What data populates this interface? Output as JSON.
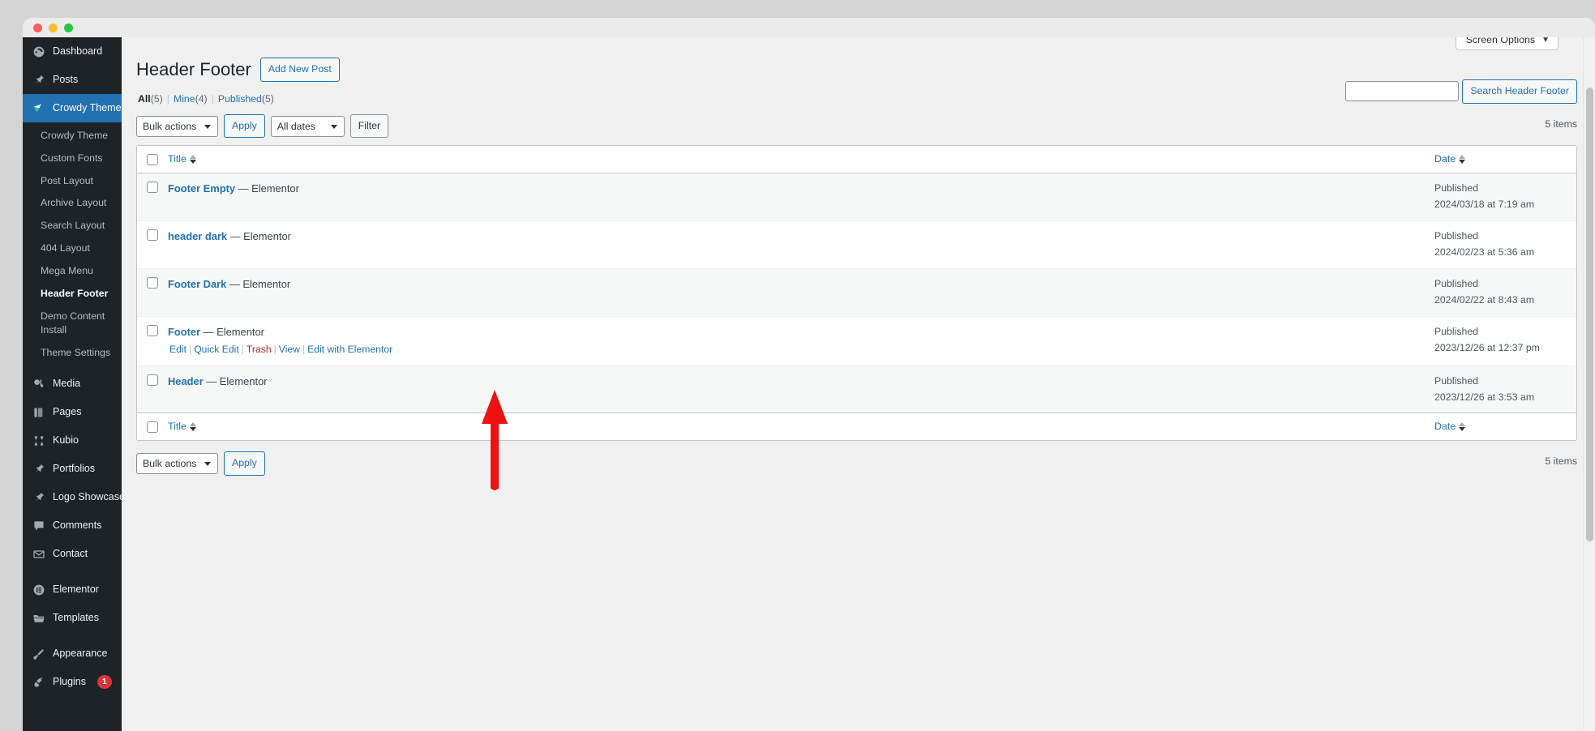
{
  "window": {
    "traffic_lights": [
      "close",
      "minimize",
      "maximize"
    ]
  },
  "sidebar": {
    "items": [
      {
        "label": "Dashboard",
        "icon": "dashboard-icon",
        "current": false
      },
      {
        "label": "Posts",
        "icon": "pin-icon",
        "current": false
      },
      {
        "label": "Crowdy Theme",
        "icon": "crowdy-logo-icon",
        "current": true
      }
    ],
    "submenu": [
      {
        "label": "Crowdy Theme",
        "active": false
      },
      {
        "label": "Custom Fonts",
        "active": false
      },
      {
        "label": "Post Layout",
        "active": false
      },
      {
        "label": "Archive Layout",
        "active": false
      },
      {
        "label": "Search Layout",
        "active": false
      },
      {
        "label": "404 Layout",
        "active": false
      },
      {
        "label": "Mega Menu",
        "active": false
      },
      {
        "label": "Header Footer",
        "active": true
      },
      {
        "label": "Demo Content Install",
        "active": false
      },
      {
        "label": "Theme Settings",
        "active": false
      }
    ],
    "items_after": [
      {
        "label": "Media",
        "icon": "media-icon",
        "badge": null
      },
      {
        "label": "Pages",
        "icon": "pages-icon",
        "badge": null
      },
      {
        "label": "Kubio",
        "icon": "kubio-icon",
        "badge": null
      },
      {
        "label": "Portfolios",
        "icon": "pin-icon",
        "badge": null
      },
      {
        "label": "Logo Showcases",
        "icon": "pin-icon",
        "badge": null
      },
      {
        "label": "Comments",
        "icon": "comment-icon",
        "badge": null
      },
      {
        "label": "Contact",
        "icon": "mail-icon",
        "badge": null
      }
    ],
    "items_group3": [
      {
        "label": "Elementor",
        "icon": "elementor-icon",
        "badge": null
      },
      {
        "label": "Templates",
        "icon": "folder-icon",
        "badge": null
      }
    ],
    "items_group4": [
      {
        "label": "Appearance",
        "icon": "brush-icon",
        "badge": null
      },
      {
        "label": "Plugins",
        "icon": "plug-icon",
        "badge": "1"
      }
    ]
  },
  "screen_meta": {
    "screen_options_label": "Screen Options",
    "caret": "▼"
  },
  "header": {
    "page_title": "Header Footer",
    "add_new_label": "Add New Post"
  },
  "filters": {
    "all_label": "All",
    "all_count": "(5)",
    "mine_label": "Mine",
    "mine_count": "(4)",
    "published_label": "Published",
    "published_count": "(5)",
    "separator": "|"
  },
  "search": {
    "value": "",
    "placeholder": "",
    "button_label": "Search Header Footer"
  },
  "tablenav_top": {
    "bulk_actions_label": "Bulk actions",
    "apply_label": "Apply",
    "dates_label": "All dates",
    "filter_label": "Filter",
    "items_count": "5 items"
  },
  "tablenav_bottom": {
    "bulk_actions_label": "Bulk actions",
    "apply_label": "Apply",
    "items_count": "5 items"
  },
  "table": {
    "columns": {
      "title": "Title",
      "date": "Date"
    },
    "rows": [
      {
        "title": "Footer Empty",
        "suffix": "— Elementor",
        "status": "Published",
        "date": "2024/03/18 at 7:19 am",
        "actions_visible": false
      },
      {
        "title": "header dark",
        "suffix": "— Elementor",
        "status": "Published",
        "date": "2024/02/23 at 5:36 am",
        "actions_visible": false
      },
      {
        "title": "Footer Dark",
        "suffix": "— Elementor",
        "status": "Published",
        "date": "2024/02/22 at 8:43 am",
        "actions_visible": false
      },
      {
        "title": "Footer",
        "suffix": "— Elementor",
        "status": "Published",
        "date": "2023/12/26 at 12:37 pm",
        "actions_visible": true,
        "actions": {
          "edit": "Edit",
          "quick_edit": "Quick Edit",
          "trash": "Trash",
          "view": "View",
          "edit_with_elementor": "Edit with Elementor"
        }
      },
      {
        "title": "Header",
        "suffix": "— Elementor",
        "status": "Published",
        "date": "2023/12/26 at 3:53 am",
        "actions_visible": false
      }
    ]
  },
  "annotation": {
    "type": "arrow-up",
    "color": "#ee1111",
    "points_to": "Edit with Elementor"
  },
  "colors": {
    "sidebar_bg": "#1d2327",
    "accent": "#2271b1",
    "link": "#2271b1",
    "trash": "#b32d2e",
    "badge": "#d63638",
    "page_bg": "#f0f0f1"
  }
}
